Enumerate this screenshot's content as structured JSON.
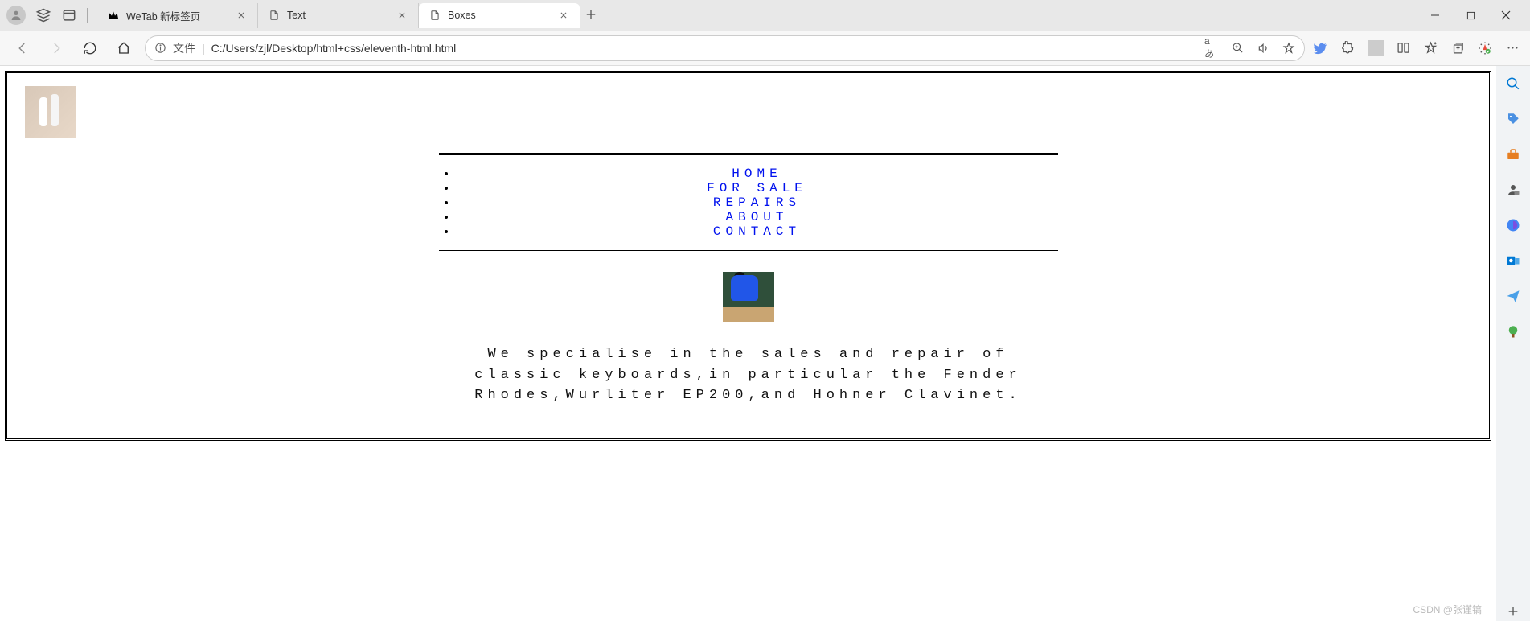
{
  "tabs": [
    {
      "title": "WeTab 新标签页",
      "icon": "crown"
    },
    {
      "title": "Text",
      "icon": "file"
    },
    {
      "title": "Boxes",
      "icon": "file"
    }
  ],
  "active_tab": 2,
  "address": {
    "label": "文件",
    "url": "C:/Users/zjl/Desktop/html+css/eleventh-html.html",
    "translate_label": "aあ"
  },
  "page": {
    "nav": [
      "HOME",
      "FOR SALE",
      "REPAIRS",
      "ABOUT",
      "CONTACT"
    ],
    "description": "We specialise in the sales and repair of classic keyboards,in particular the Fender Rhodes,Wurliter EP200,and Hohner Clavinet."
  },
  "watermark": "CSDN @张谨镐"
}
